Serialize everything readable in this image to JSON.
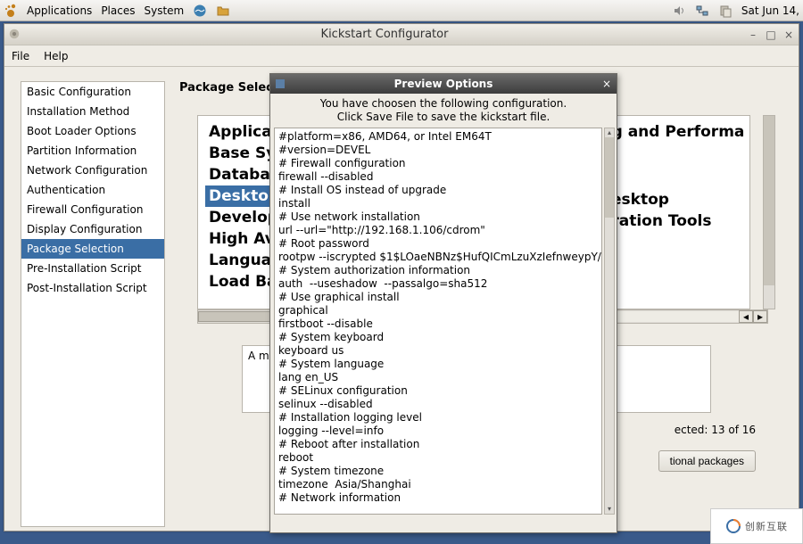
{
  "panel": {
    "applications": "Applications",
    "places": "Places",
    "system": "System",
    "clock": "Sat Jun 14,"
  },
  "window": {
    "title": "Kickstart Configurator"
  },
  "menubar": {
    "file": "File",
    "help": "Help"
  },
  "sidebar": {
    "items": [
      "Basic Configuration",
      "Installation Method",
      "Boot Loader Options",
      "Partition Information",
      "Network Configuration",
      "Authentication",
      "Firewall Configuration",
      "Display Configuration",
      "Package Selection",
      "Pre-Installation Script",
      "Post-Installation Script"
    ],
    "selected_index": 8
  },
  "content": {
    "page_title": "Package Selection",
    "groups_left": [
      "Applications",
      "Base System",
      "Databases",
      "Desktops",
      "Development",
      "High Availability",
      "Languages",
      "Load Balancer"
    ],
    "groups_left_selected_index": 3,
    "groups_right_visible_fragments": [
      "gging and Performa",
      "rm",
      "se Desktop",
      "inistration Tools"
    ],
    "desc_prefix": "A min",
    "selected_count_text": "ected: 13 of 16",
    "optional_btn_text_visible": "tional packages"
  },
  "dialog": {
    "title": "Preview Options",
    "msg1": "You have choosen the following configuration.",
    "msg2": "Click Save File to save the kickstart file.",
    "kickstart_lines": [
      "#platform=x86, AMD64, or Intel EM64T",
      "#version=DEVEL",
      "# Firewall configuration",
      "firewall --disabled",
      "# Install OS instead of upgrade",
      "install",
      "# Use network installation",
      "url --url=\"http://192.168.1.106/cdrom\"",
      "# Root password",
      "rootpw --iscrypted $1$LOaeNBNz$HufQICmLzuXzIefnweypY/",
      "# System authorization information",
      "auth  --useshadow  --passalgo=sha512",
      "# Use graphical install",
      "graphical",
      "firstboot --disable",
      "# System keyboard",
      "keyboard us",
      "# System language",
      "lang en_US",
      "# SELinux configuration",
      "selinux --disabled",
      "# Installation logging level",
      "logging --level=info",
      "# Reboot after installation",
      "reboot",
      "# System timezone",
      "timezone  Asia/Shanghai",
      "# Network information"
    ]
  },
  "watermark": "创新互联"
}
